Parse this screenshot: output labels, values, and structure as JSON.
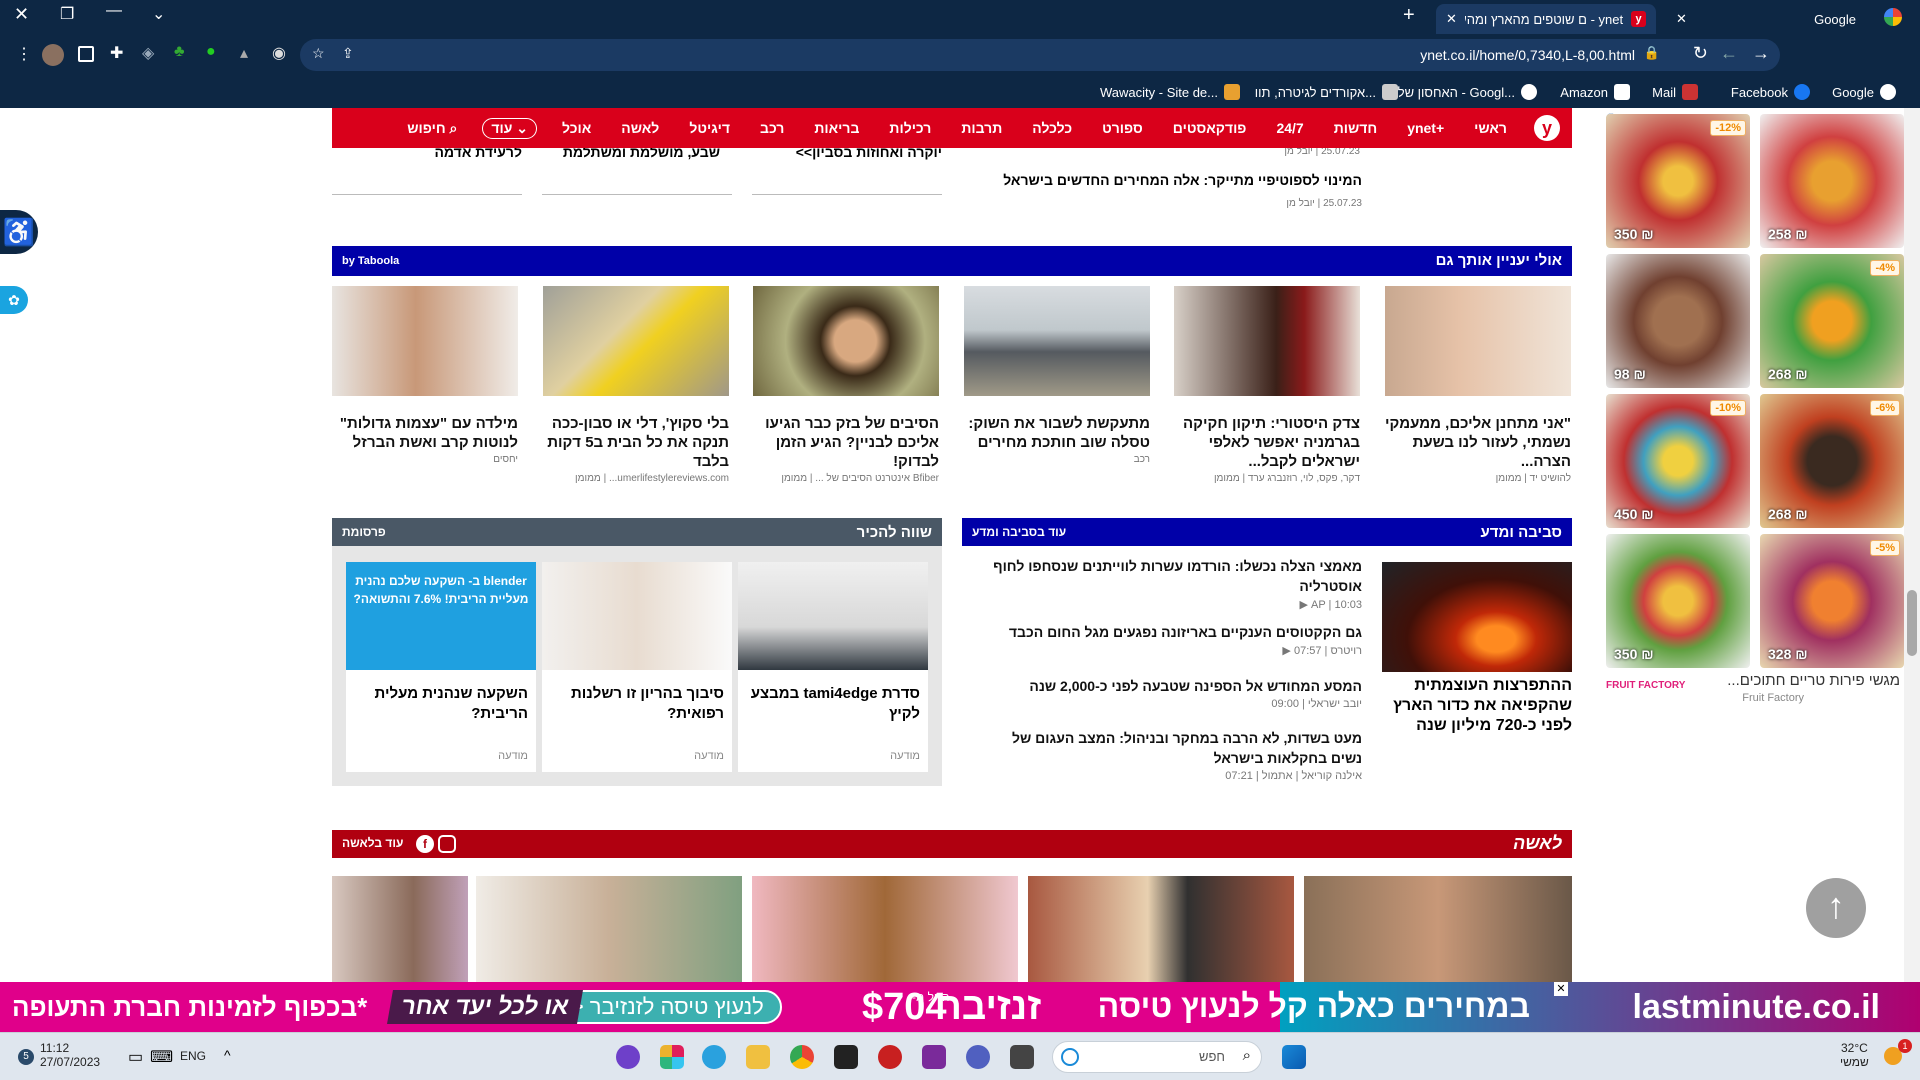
{
  "browser": {
    "tabs": [
      {
        "label": "Google",
        "active": false
      },
      {
        "label": "ynet - חדשות, כלכלה, ספורט ובריאות - דיווחים שוטפים מהארץ ומהעולם",
        "display": "ynet - ם שוטפים מהארץ ומהעולם",
        "active": true
      }
    ],
    "url": "ynet.co.il/home/0,7340,L-8,00.html",
    "bookmarks": [
      "Google",
      "Facebook",
      "Mail",
      "Amazon",
      "האחסון שלי - Googl...",
      "אקורדים לגיטרה, תוו...",
      "Wawacity - Site de..."
    ]
  },
  "nav": {
    "items": [
      "ראשי",
      "ynet+",
      "חדשות",
      "24/7",
      "פודקאסטים",
      "ספורט",
      "כלכלה",
      "תרבות",
      "רכילות",
      "בריאות",
      "רכב",
      "דיגיטל",
      "לאשה",
      "אוכל"
    ],
    "more": "עוד",
    "search": "חיפוש"
  },
  "top_strip": {
    "partial_headlines": [
      "יוקרה ואחוזות בסביון>>",
      "שבע, מושלמת ומשתלמת",
      "לרעידת אדמה"
    ],
    "items": [
      {
        "meta": "25.07.23 | יובל מן"
      },
      {
        "headline": "המינוי לספוטיפיי מתייקר: אלה המחירים החדשים בישראל",
        "meta": "25.07.23 | יובל מן"
      }
    ]
  },
  "taboola": {
    "title": "אולי יעניין אותך גם",
    "by": "by Taboola",
    "cards": [
      {
        "title": "\"אני מתחנן אליכם, ממעמקי נשמתי, לעזור לנו בשעת הצרה...",
        "source": "להושיט יד | ממומן"
      },
      {
        "title": "צדק היסטורי: תיקון חקיקה בגרמניה יאפשר לאלפי ישראלים לקבל...",
        "source": "דקר, פקס, לוי, רוזנברג ערד | ממומן"
      },
      {
        "title": "מתעקשת לשבור את השוק: טסלה שוב חותכת מחירים",
        "source": "רכב"
      },
      {
        "title": "הסיבים של בזק כבר הגיעו אליכם לבניין? הגיע הזמן לבדוק!",
        "source": "Bfiber אינטרנט הסיבים של ... | ממומן"
      },
      {
        "title": "בלי סקוץ', דלי או סבון-ככה תנקה את כל הבית ב5 דקות בלבד",
        "source": "umerlifestylereviews.com... | ממומן"
      },
      {
        "title": "מילדה עם \"עצמות גדולות\" לנוטות קרב ואשת הברזל",
        "source": "יחסים"
      }
    ]
  },
  "science": {
    "title": "סביבה ומדע",
    "more": "עוד בסביבה ומדע",
    "feature": "ההתפרצות העוצמתית שהקפיאה את כדור הארץ לפני כ-720 מיליון שנה",
    "items": [
      {
        "headline": "מאמצי הצלה נכשלו: הורדמו עשרות לווייתנים שנסחפו לחוף אוסטרליה",
        "meta": "AP | 10:03"
      },
      {
        "headline": "גם הקקטוסים הענקיים באריזונה נפגעים מגל החום הכבד",
        "meta": "רויטרס | 07:57"
      },
      {
        "headline": "המסע המחודש אל הספינה שטבעה לפני כ-2,000 שנה",
        "meta": "יובב ישראלי | 09:00"
      },
      {
        "headline": "מעט בשדות, לא הרבה במחקר ובניהול: המצב העגום של נשים בחקלאות בישראל",
        "meta": "אילנה קוריאל | אתמול | 07:21"
      }
    ]
  },
  "worth": {
    "title": "שווה להכיר",
    "label": "פרסומת",
    "cards": [
      {
        "title": "סדרת tami4edge במבצע לקיץ",
        "sponsor": "מודעה"
      },
      {
        "title": "סיבוך בהריון זו רשלנות רפואית?",
        "sponsor": "מודעה"
      },
      {
        "title": "השקעה שנהנית מעלית הריבית?",
        "sponsor": "מודעה",
        "ad_text": "blender ב- השקעה שלכם נהנית מעליית הריבית! 7.6% והתשואה?"
      }
    ]
  },
  "woman": {
    "logo": "לאשה",
    "more": "עוד בלאשה"
  },
  "side_ad": {
    "items": [
      {
        "price": "258 ₪",
        "discount": "-12%"
      },
      {
        "price": "350 ₪",
        "discount": ""
      },
      {
        "price": "268 ₪",
        "discount": "-4%"
      },
      {
        "price": "98 ₪",
        "discount": ""
      },
      {
        "price": "268 ₪",
        "discount": "-6%"
      },
      {
        "price": "450 ₪",
        "discount": "-10%"
      },
      {
        "price": "328 ₪",
        "discount": "-5%"
      },
      {
        "price": "350 ₪",
        "discount": ""
      }
    ],
    "caption": "מגשי פירות טריים חתוכים...",
    "brand": "Fruit Factory",
    "logo": "FRUIT FACTORY"
  },
  "banner": {
    "brand": "lastminute.co.il",
    "headline": "במחירים כאלה קל לנעוץ טיסה",
    "dest": "זנזיבר",
    "from": "החל מ-",
    "price": "$704",
    "cta": "לנעוץ טיסה לזנזיבר <<",
    "tag": "או לכל יעד אחר",
    "note": "*בכפוף לזמינות חברת התעופה"
  },
  "taskbar": {
    "time": "11:12",
    "date": "27/07/2023",
    "lang": "ENG",
    "weather": "32°C",
    "weather_desc": "שמשי",
    "search_placeholder": "חפש",
    "badge": "1"
  }
}
